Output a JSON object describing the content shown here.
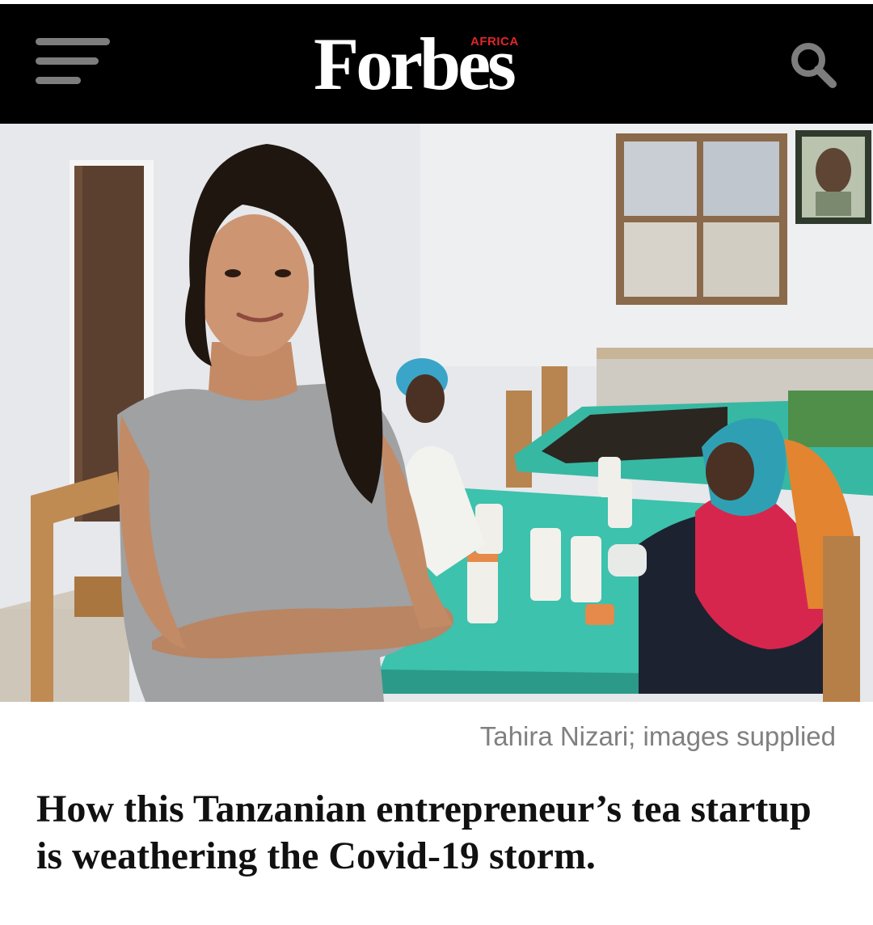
{
  "header": {
    "logo_text": "Forbes",
    "logo_region": "AFRICA",
    "menu_icon": "hamburger-menu-icon",
    "search_icon": "search-icon",
    "brand_color": "#000000",
    "region_color": "#e0262b"
  },
  "article": {
    "image_caption": "Tahira Nizari; images supplied",
    "headline": "How this Tanzanian entrepreneur’s tea startup is weathering the Covid-19 storm."
  }
}
